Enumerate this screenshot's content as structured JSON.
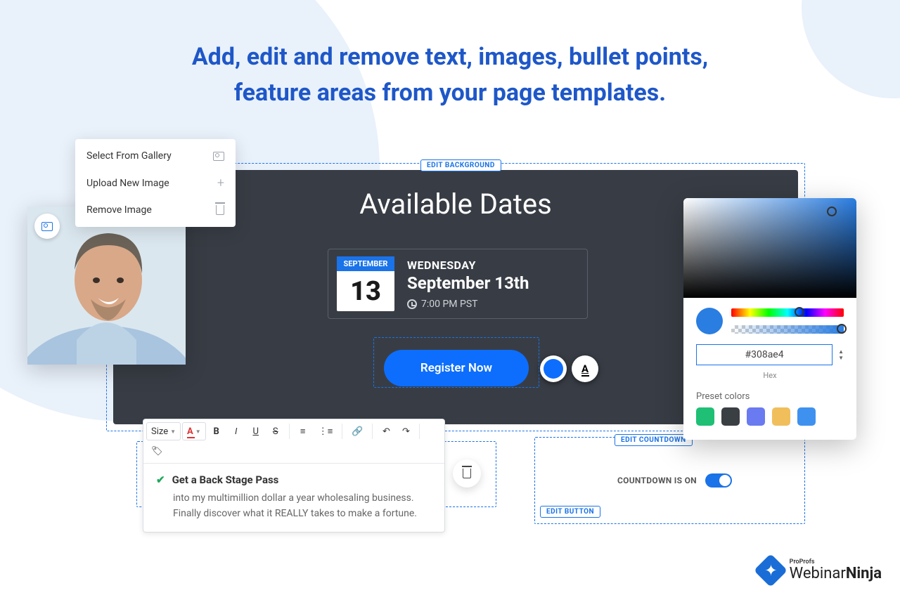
{
  "heading_line1": "Add, edit and remove text, images, bullet points,",
  "heading_line2": "feature areas from your page templates.",
  "edit_background_label": "EDIT BACKGROUND",
  "available_dates_title": "Available Dates",
  "date": {
    "month": "SEPTEMBER",
    "day_num": "13",
    "weekday": "WEDNESDAY",
    "full": "September 13th",
    "time": "7:00 PM PST"
  },
  "edit_button_label": "EDIT BUTTON",
  "register_label": "Register Now",
  "image_menu": {
    "select_gallery": "Select From Gallery",
    "upload_new": "Upload New Image",
    "remove": "Remove Image"
  },
  "toolbar": {
    "size_label": "Size"
  },
  "bullet": {
    "title": "Get a Back Stage Pass",
    "body": "into my multimillion dollar a year wholesaling business. Finally discover what it REALLY takes to make a fortune."
  },
  "edit_countdown_label": "EDIT COUNTDOWN",
  "countdown_on_label": "COUNTDOWN IS ON",
  "color_picker": {
    "hex_value": "#308ae4",
    "hex_label": "Hex",
    "preset_label": "Preset colors",
    "presets": [
      "#1fbf75",
      "#3a3f44",
      "#6a7af0",
      "#f0bf5c",
      "#3f91f0"
    ]
  },
  "logo": {
    "small": "ProProfs",
    "main_thin": "Webinar",
    "main_bold": "Ninja"
  }
}
